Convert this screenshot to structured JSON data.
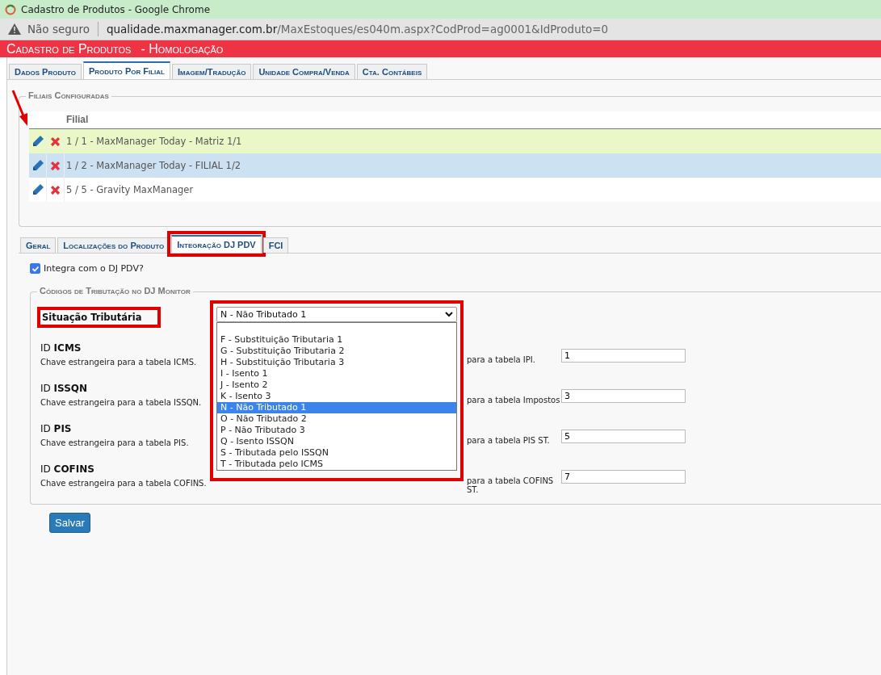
{
  "browser": {
    "title": "Cadastro de Produtos - Google Chrome",
    "security": "Não seguro",
    "url_host": "qualidade.maxmanager.com.br",
    "url_path": "/MaxEstoques/es040m.aspx?CodProd=ag0001&IdProduto=0"
  },
  "header": {
    "title": "Cadastro de Produtos",
    "environment": "- Homologação"
  },
  "tabs": [
    {
      "label": "Dados Produto",
      "selected": false
    },
    {
      "label": "Produto Por Filial",
      "selected": true
    },
    {
      "label": "Imagem/Tradução",
      "selected": false
    },
    {
      "label": "Unidade Compra/Venda",
      "selected": false
    },
    {
      "label": "Cta. Contábeis",
      "selected": false
    }
  ],
  "branches": {
    "legend": "Filiais Configuradas",
    "columns": [
      "Filial"
    ],
    "rows": [
      {
        "filial": "1 / 1 - MaxManager Today - Matriz 1/1",
        "hovered": true,
        "selected": false,
        "pointed": true
      },
      {
        "filial": "1 / 2 - MaxManager Today - FILIAL 1/2",
        "hovered": false,
        "selected": true,
        "pointed": false
      },
      {
        "filial": "5 / 5 - Gravity MaxManager",
        "hovered": false,
        "selected": false,
        "pointed": false
      }
    ]
  },
  "subtabs": [
    {
      "label": "Geral",
      "selected": false,
      "annotated": false
    },
    {
      "label": "Localizações do Produto",
      "selected": false,
      "annotated": false
    },
    {
      "label": "Integração DJ PDV",
      "selected": true,
      "annotated": true
    },
    {
      "label": "FCI",
      "selected": false,
      "annotated": false
    }
  ],
  "integrate": {
    "label": "Integra com o DJ PDV?",
    "checked": true
  },
  "tax_codes": {
    "legend": "Códigos de Tributação no DJ Monitor",
    "situation": {
      "label": "Situação Tributária",
      "annotated": true,
      "value": "N - Não Tributado 1",
      "expanded": true,
      "options": [
        {
          "label": "F - Substituição Tributaria 1",
          "selected": false
        },
        {
          "label": "G - Substituição Tributaria 2",
          "selected": false
        },
        {
          "label": "H - Substituição Tributaria 3",
          "selected": false
        },
        {
          "label": "I - Isento 1",
          "selected": false
        },
        {
          "label": "J - Isento 2",
          "selected": false
        },
        {
          "label": "K - Isento 3",
          "selected": false
        },
        {
          "label": "N - Não Tributado 1",
          "selected": true
        },
        {
          "label": "O - Não Tributado 2",
          "selected": false
        },
        {
          "label": "P - Não Tributado 3",
          "selected": false
        },
        {
          "label": "Q - Isento ISSQN",
          "selected": false
        },
        {
          "label": "S - Tributada pelo ISSQN",
          "selected": false
        },
        {
          "label": "T - Tributada pelo ICMS",
          "selected": false
        }
      ]
    },
    "rows": [
      {
        "prefix": "ID",
        "code": "ICMS",
        "description": "Chave estrangeira para a tabela ICMS.",
        "right_description": "para a tabela IPI.",
        "right_value": "1"
      },
      {
        "prefix": "ID",
        "code": "ISSQN",
        "description": "Chave estrangeira para a tabela ISSQN.",
        "right_description": "para a tabela Impostos",
        "right_value": "3"
      },
      {
        "prefix": "ID",
        "code": "PIS",
        "description": "Chave estrangeira para a tabela PIS.",
        "right_description": "para a tabela PIS ST.",
        "right_value": "5"
      },
      {
        "prefix": "ID",
        "code": "COFINS",
        "description": "Chave estrangeira para a tabela COFINS.",
        "right_description": "para a tabela COFINS ST.",
        "right_value": "7"
      }
    ]
  },
  "save_button": "Salvar"
}
